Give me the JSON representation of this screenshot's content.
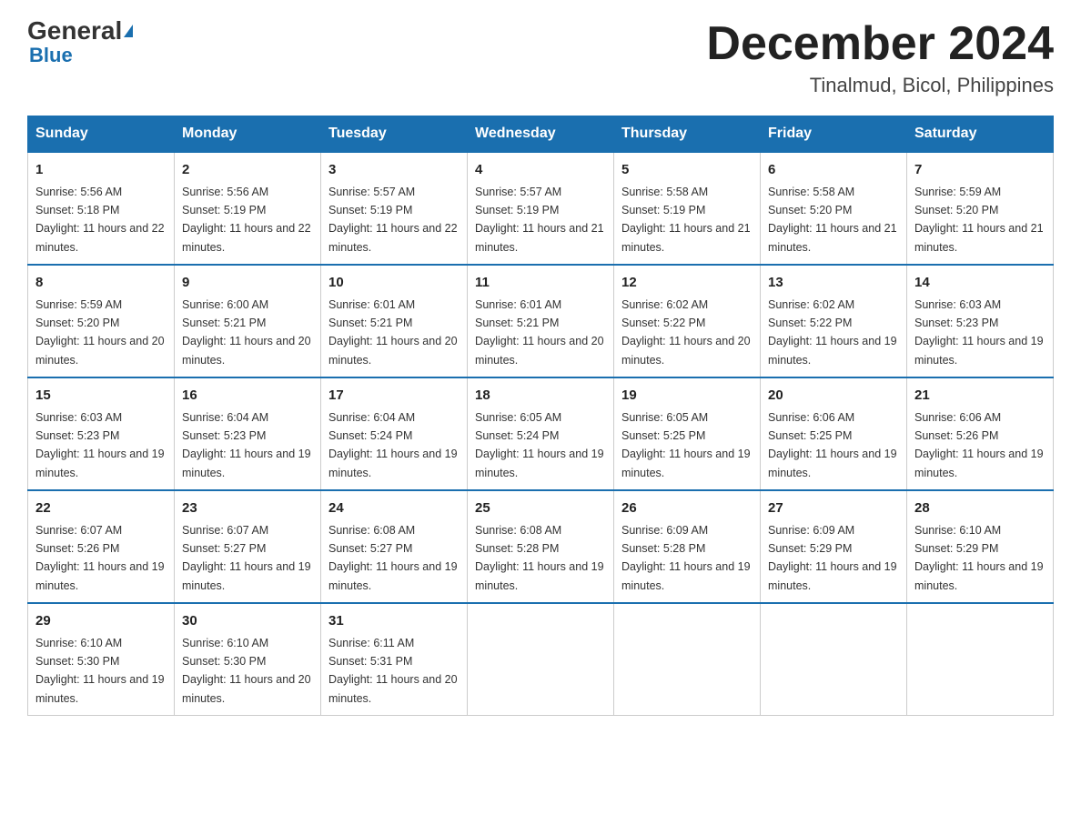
{
  "header": {
    "logo_general": "General",
    "logo_blue": "Blue",
    "month_title": "December 2024",
    "location": "Tinalmud, Bicol, Philippines"
  },
  "days_of_week": [
    "Sunday",
    "Monday",
    "Tuesday",
    "Wednesday",
    "Thursday",
    "Friday",
    "Saturday"
  ],
  "weeks": [
    [
      {
        "day": "1",
        "sunrise": "5:56 AM",
        "sunset": "5:18 PM",
        "daylight": "11 hours and 22 minutes."
      },
      {
        "day": "2",
        "sunrise": "5:56 AM",
        "sunset": "5:19 PM",
        "daylight": "11 hours and 22 minutes."
      },
      {
        "day": "3",
        "sunrise": "5:57 AM",
        "sunset": "5:19 PM",
        "daylight": "11 hours and 22 minutes."
      },
      {
        "day": "4",
        "sunrise": "5:57 AM",
        "sunset": "5:19 PM",
        "daylight": "11 hours and 21 minutes."
      },
      {
        "day": "5",
        "sunrise": "5:58 AM",
        "sunset": "5:19 PM",
        "daylight": "11 hours and 21 minutes."
      },
      {
        "day": "6",
        "sunrise": "5:58 AM",
        "sunset": "5:20 PM",
        "daylight": "11 hours and 21 minutes."
      },
      {
        "day": "7",
        "sunrise": "5:59 AM",
        "sunset": "5:20 PM",
        "daylight": "11 hours and 21 minutes."
      }
    ],
    [
      {
        "day": "8",
        "sunrise": "5:59 AM",
        "sunset": "5:20 PM",
        "daylight": "11 hours and 20 minutes."
      },
      {
        "day": "9",
        "sunrise": "6:00 AM",
        "sunset": "5:21 PM",
        "daylight": "11 hours and 20 minutes."
      },
      {
        "day": "10",
        "sunrise": "6:01 AM",
        "sunset": "5:21 PM",
        "daylight": "11 hours and 20 minutes."
      },
      {
        "day": "11",
        "sunrise": "6:01 AM",
        "sunset": "5:21 PM",
        "daylight": "11 hours and 20 minutes."
      },
      {
        "day": "12",
        "sunrise": "6:02 AM",
        "sunset": "5:22 PM",
        "daylight": "11 hours and 20 minutes."
      },
      {
        "day": "13",
        "sunrise": "6:02 AM",
        "sunset": "5:22 PM",
        "daylight": "11 hours and 19 minutes."
      },
      {
        "day": "14",
        "sunrise": "6:03 AM",
        "sunset": "5:23 PM",
        "daylight": "11 hours and 19 minutes."
      }
    ],
    [
      {
        "day": "15",
        "sunrise": "6:03 AM",
        "sunset": "5:23 PM",
        "daylight": "11 hours and 19 minutes."
      },
      {
        "day": "16",
        "sunrise": "6:04 AM",
        "sunset": "5:23 PM",
        "daylight": "11 hours and 19 minutes."
      },
      {
        "day": "17",
        "sunrise": "6:04 AM",
        "sunset": "5:24 PM",
        "daylight": "11 hours and 19 minutes."
      },
      {
        "day": "18",
        "sunrise": "6:05 AM",
        "sunset": "5:24 PM",
        "daylight": "11 hours and 19 minutes."
      },
      {
        "day": "19",
        "sunrise": "6:05 AM",
        "sunset": "5:25 PM",
        "daylight": "11 hours and 19 minutes."
      },
      {
        "day": "20",
        "sunrise": "6:06 AM",
        "sunset": "5:25 PM",
        "daylight": "11 hours and 19 minutes."
      },
      {
        "day": "21",
        "sunrise": "6:06 AM",
        "sunset": "5:26 PM",
        "daylight": "11 hours and 19 minutes."
      }
    ],
    [
      {
        "day": "22",
        "sunrise": "6:07 AM",
        "sunset": "5:26 PM",
        "daylight": "11 hours and 19 minutes."
      },
      {
        "day": "23",
        "sunrise": "6:07 AM",
        "sunset": "5:27 PM",
        "daylight": "11 hours and 19 minutes."
      },
      {
        "day": "24",
        "sunrise": "6:08 AM",
        "sunset": "5:27 PM",
        "daylight": "11 hours and 19 minutes."
      },
      {
        "day": "25",
        "sunrise": "6:08 AM",
        "sunset": "5:28 PM",
        "daylight": "11 hours and 19 minutes."
      },
      {
        "day": "26",
        "sunrise": "6:09 AM",
        "sunset": "5:28 PM",
        "daylight": "11 hours and 19 minutes."
      },
      {
        "day": "27",
        "sunrise": "6:09 AM",
        "sunset": "5:29 PM",
        "daylight": "11 hours and 19 minutes."
      },
      {
        "day": "28",
        "sunrise": "6:10 AM",
        "sunset": "5:29 PM",
        "daylight": "11 hours and 19 minutes."
      }
    ],
    [
      {
        "day": "29",
        "sunrise": "6:10 AM",
        "sunset": "5:30 PM",
        "daylight": "11 hours and 19 minutes."
      },
      {
        "day": "30",
        "sunrise": "6:10 AM",
        "sunset": "5:30 PM",
        "daylight": "11 hours and 20 minutes."
      },
      {
        "day": "31",
        "sunrise": "6:11 AM",
        "sunset": "5:31 PM",
        "daylight": "11 hours and 20 minutes."
      },
      null,
      null,
      null,
      null
    ]
  ]
}
